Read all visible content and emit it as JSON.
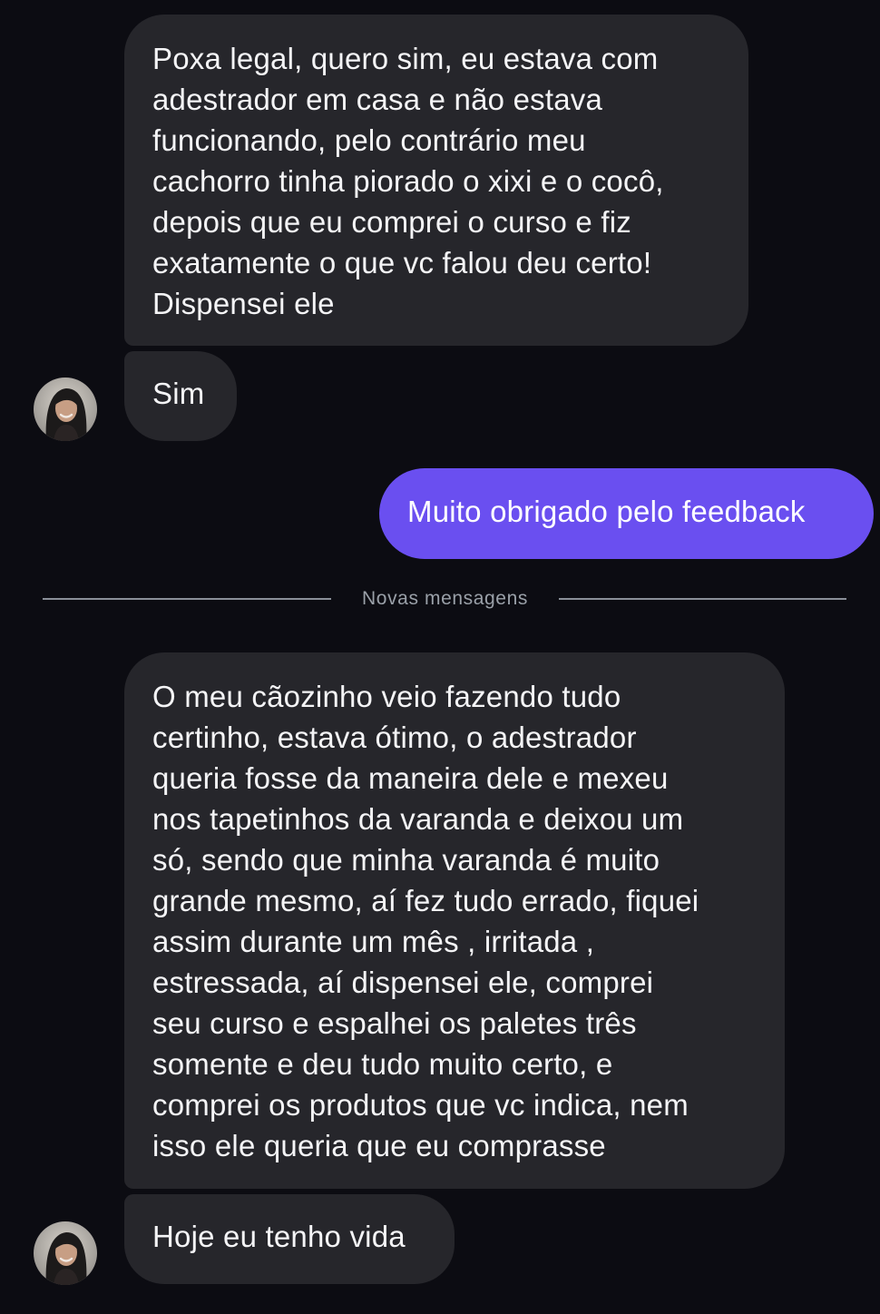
{
  "messages": [
    {
      "id": "msg1",
      "sender": "contact",
      "text": "Poxa legal, quero sim, eu estava com\nadestrador em casa e não estava\nfuncionando, pelo contrário meu\ncachorro tinha piorado o xixi e o cocô,\ndepois que eu comprei o curso e fiz\nexatamente o que vc falou deu certo!\nDispensei ele"
    },
    {
      "id": "msg2",
      "sender": "contact",
      "text": "Sim"
    },
    {
      "id": "msg3",
      "sender": "me",
      "text": "Muito obrigado pelo feedback"
    },
    {
      "id": "msg4",
      "sender": "contact",
      "text": "O meu cãozinho veio fazendo tudo\ncertinho, estava ótimo, o adestrador\nqueria fosse da maneira dele e mexeu\nnos tapetinhos da varanda e deixou um\nsó, sendo que minha varanda é muito\ngrande mesmo, aí fez tudo errado, fiquei\nassim durante um mês , irritada ,\nestressada, aí dispensei ele, comprei\nseu curso e espalhei os paletes três\nsomente e deu tudo muito certo, e\ncomprei os produtos que vc indica, nem\nisso ele queria que eu comprasse"
    },
    {
      "id": "msg5",
      "sender": "contact",
      "text": "Hoje eu tenho vida"
    }
  ],
  "divider": {
    "label": "Novas mensagens"
  },
  "colors": {
    "background": "#0c0c12",
    "incoming_bubble": "#26262b",
    "outgoing_bubble": "#6a4ff0",
    "divider_text": "#9aa0a8"
  },
  "icons": {
    "avatar": "contact-avatar-photo"
  }
}
